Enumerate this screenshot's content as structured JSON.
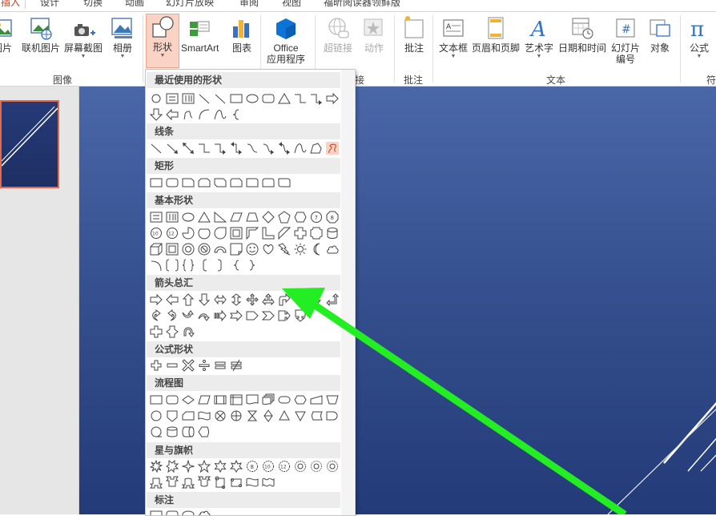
{
  "ribbon_tabs": [
    "插入",
    "设计",
    "切换",
    "动画",
    "幻灯片放映",
    "审阅",
    "视图",
    "福昕阅读器领鲜版"
  ],
  "ribbon_buttons": {
    "picture": "图片",
    "online_picture": "联机图片",
    "screenshot": "屏幕截图",
    "album": "相册",
    "shapes": "形状",
    "smartart": "SmartArt",
    "chart": "图表",
    "office_apps_line1": "Office",
    "office_apps_line2": "应用程序",
    "hyperlink": "超链接",
    "action": "动作",
    "comment": "批注",
    "textbox": "文本框",
    "header_footer": "页眉和页脚",
    "wordart": "艺术字",
    "datetime": "日期和时间",
    "slide_number_line1": "幻灯片",
    "slide_number_line2": "编号",
    "object": "对象",
    "equation": "公式"
  },
  "ribbon_groups": {
    "images": "图像",
    "links": "接",
    "comments": "批注",
    "text": "文本",
    "symbols": "符"
  },
  "shapes_menu": {
    "recent": "最近使用的形状",
    "lines": "线条",
    "rectangles": "矩形",
    "basic": "基本形状",
    "arrows": "箭头总汇",
    "equation": "公式形状",
    "flowchart": "流程图",
    "stars": "星与旗帜",
    "callouts": "标注",
    "num_10": "10",
    "num_12": "12",
    "num_7": "7",
    "num_8": "8",
    "num_6": "6"
  },
  "colors": {
    "accent": "#c43e1c",
    "highlight": "#fbd3c5",
    "annotation_arrow": "#22ee22"
  }
}
